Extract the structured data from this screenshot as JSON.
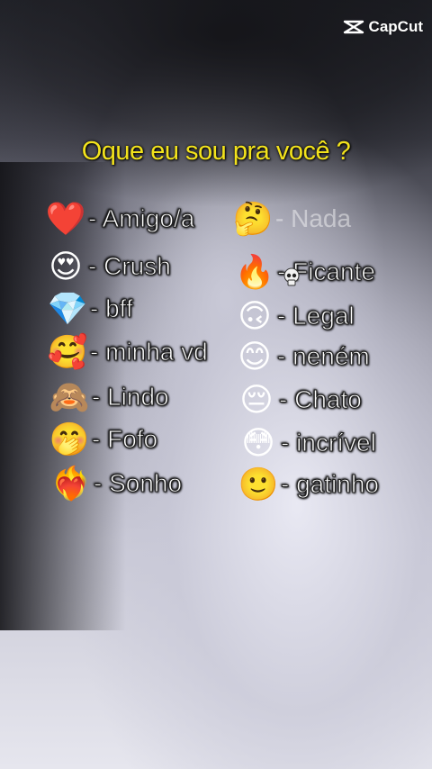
{
  "watermark": {
    "text": "CapCut"
  },
  "title": "Oque eu sou pra você ?",
  "left_items": [
    {
      "emoji": "❤️",
      "label": "- Amigo/a"
    },
    {
      "emoji": "😍",
      "label": "- Crush"
    },
    {
      "emoji": "💎",
      "label": "- bff"
    },
    {
      "emoji": "🥰",
      "label": "- minha vd"
    },
    {
      "emoji": "🙈",
      "label": "- Lindo"
    },
    {
      "emoji": "🤭",
      "label": "- Fofo"
    },
    {
      "emoji": "❤️‍🔥",
      "label": "- Sonho"
    }
  ],
  "right_items": [
    {
      "emoji": "🤔",
      "label": "- Nada"
    },
    {
      "emoji": "🔥",
      "label": "- Ficante"
    },
    {
      "emoji": "🙃",
      "label": "- Legal"
    },
    {
      "emoji": "😊",
      "label": "- neném"
    },
    {
      "emoji": "😔",
      "label": "- Chato"
    },
    {
      "emoji": "😳",
      "label": "- incrível"
    },
    {
      "emoji": "🙂",
      "label": "- gatinho"
    }
  ],
  "colors": {
    "title": "#f3e31c",
    "label": "#ffffff"
  }
}
